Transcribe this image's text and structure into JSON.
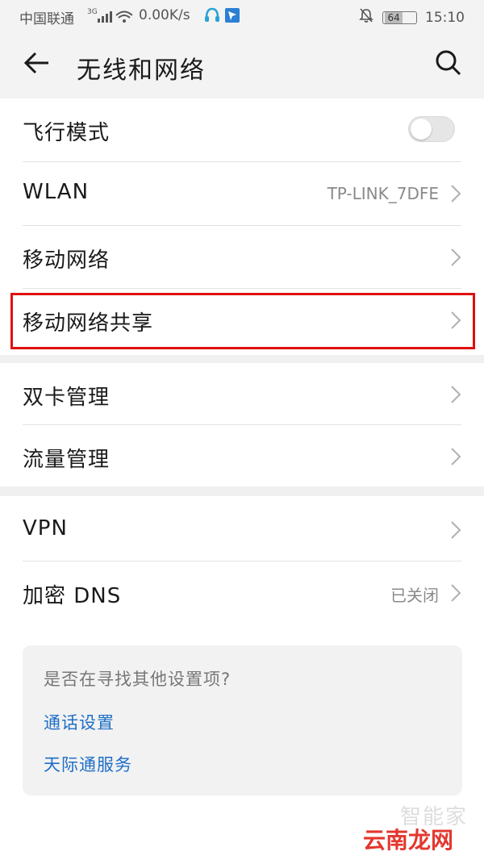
{
  "status_bar": {
    "carrier": "中国联通",
    "network": "3G",
    "speed": "0.00K/s",
    "battery": "64",
    "time": "15:10"
  },
  "header": {
    "title": "无线和网络"
  },
  "rows": {
    "airplane": {
      "label": "飞行模式",
      "toggle_on": false
    },
    "wlan": {
      "label": "WLAN",
      "value": "TP-LINK_7DFE"
    },
    "mobile_network": {
      "label": "移动网络"
    },
    "tethering": {
      "label": "移动网络共享"
    },
    "dual_sim": {
      "label": "双卡管理"
    },
    "data_usage": {
      "label": "流量管理"
    },
    "vpn": {
      "label": "VPN"
    },
    "private_dns": {
      "label": "加密 DNS",
      "value": "已关闭"
    }
  },
  "suggestions": {
    "question": "是否在寻找其他设置项?",
    "links": [
      "通话设置",
      "天际通服务"
    ]
  },
  "watermark": {
    "text": "云南龙网",
    "faint": "智能家"
  },
  "colors": {
    "highlight": "#e01010",
    "link": "#1f6fc7",
    "watermark": "#e3372f"
  }
}
